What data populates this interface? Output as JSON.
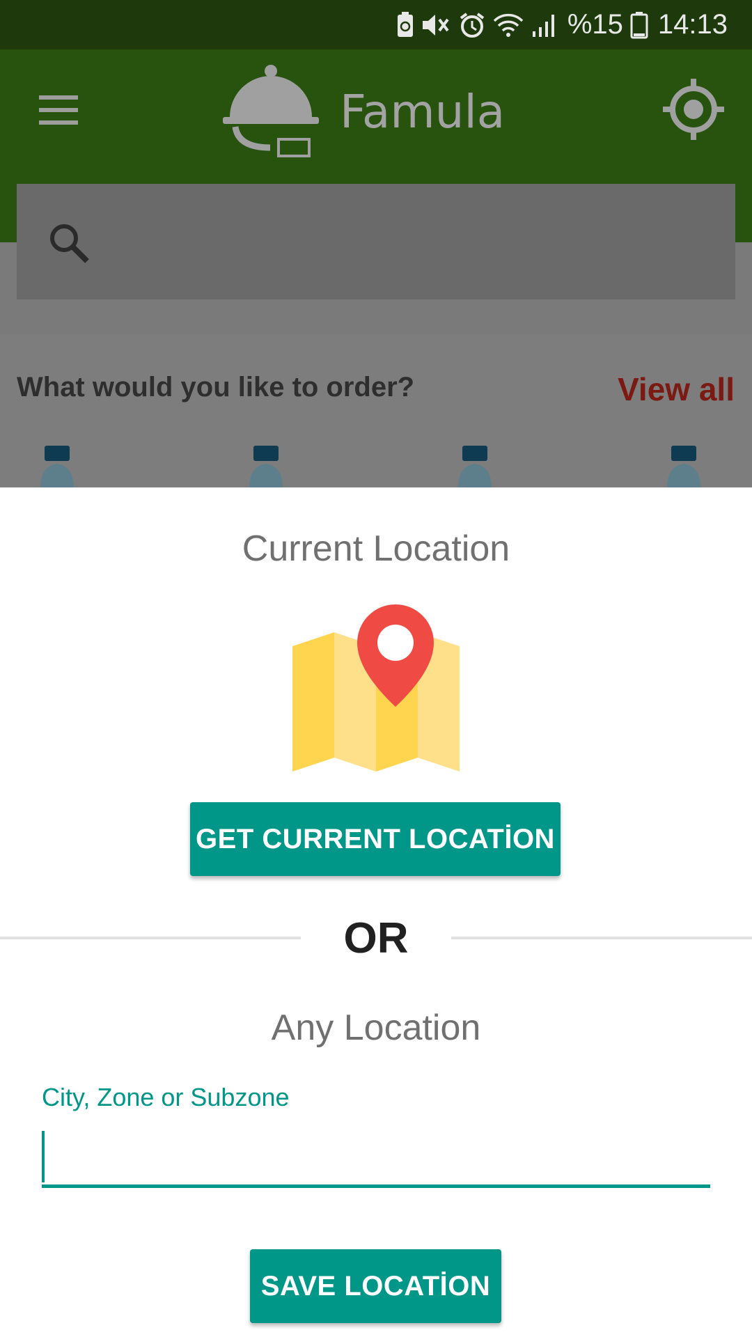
{
  "status_bar": {
    "battery_percent": "%15",
    "time": "14:13",
    "icons": [
      "battery-saver-icon",
      "mute-icon",
      "alarm-icon",
      "wifi-icon",
      "signal-icon",
      "battery-icon"
    ]
  },
  "app_bar": {
    "title": "Famula",
    "menu_icon": "hamburger-menu-icon",
    "logo_icon": "food-cloche-icon",
    "locate_icon": "crosshair-location-icon"
  },
  "search": {
    "icon": "search-icon",
    "placeholder": ""
  },
  "home": {
    "section_title": "What would you like to order?",
    "view_all_label": "View all",
    "product_icon": "water-bottle-icon"
  },
  "dialog": {
    "current_title": "Current Location",
    "map_icon": "map-pin-icon",
    "get_location_label": "GET CURRENT LOCATİON",
    "or_label": "OR",
    "any_title": "Any Location",
    "field_label": "City, Zone or Subzone",
    "field_value": "",
    "save_label": "SAVE LOCATİON"
  },
  "colors": {
    "accent": "#009688",
    "app_bar_dimmed": "#27530f",
    "status_bar": "#1e3a0c",
    "view_all": "#7a1a12",
    "map_pin": "#f04a45",
    "map_yellow": "#ffd54f",
    "map_light": "#ffe08a"
  }
}
